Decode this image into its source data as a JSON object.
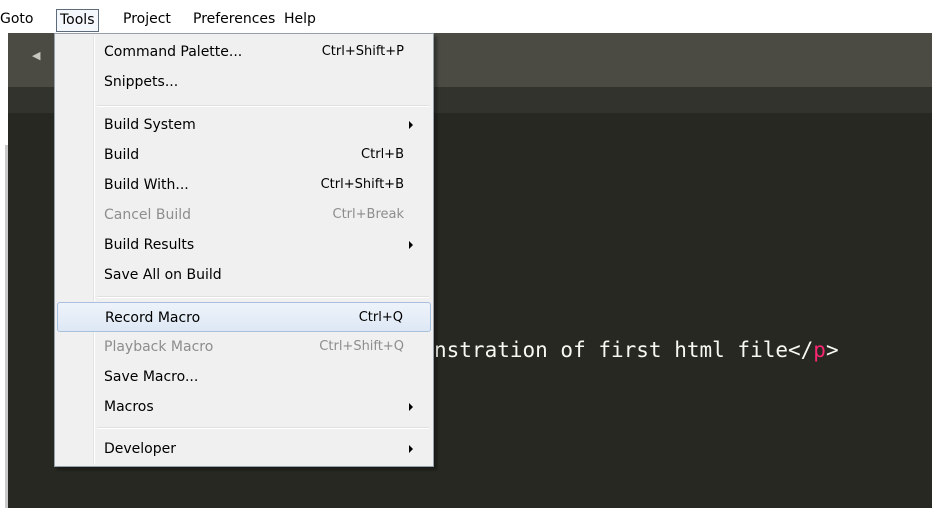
{
  "menubar": {
    "items": [
      {
        "label": "Goto"
      },
      {
        "label": "Tools"
      },
      {
        "label": "Project"
      },
      {
        "label": "Preferences"
      },
      {
        "label": "Help"
      }
    ],
    "open_menu": "Tools"
  },
  "editor": {
    "background": "#272822",
    "code_before": "nstration of first html file</",
    "code_tag": "p",
    "code_after": ">",
    "tag_color": "#f92672"
  },
  "tools_menu": {
    "items": [
      {
        "label": "Command Palette...",
        "shortcut": "Ctrl+Shift+P"
      },
      {
        "label": "Snippets...",
        "shortcut": ""
      },
      {
        "label": "Build System",
        "shortcut": "",
        "submenu": true
      },
      {
        "label": "Build",
        "shortcut": "Ctrl+B"
      },
      {
        "label": "Build With...",
        "shortcut": "Ctrl+Shift+B"
      },
      {
        "label": "Cancel Build",
        "shortcut": "Ctrl+Break",
        "disabled": true
      },
      {
        "label": "Build Results",
        "shortcut": "",
        "submenu": true
      },
      {
        "label": "Save All on Build",
        "shortcut": ""
      },
      {
        "label": "Record Macro",
        "shortcut": "Ctrl+Q",
        "highlighted": true
      },
      {
        "label": "Playback Macro",
        "shortcut": "Ctrl+Shift+Q",
        "disabled": true
      },
      {
        "label": "Save Macro...",
        "shortcut": ""
      },
      {
        "label": "Macros",
        "shortcut": "",
        "submenu": true
      },
      {
        "label": "Developer",
        "shortcut": "",
        "submenu": true
      }
    ]
  }
}
